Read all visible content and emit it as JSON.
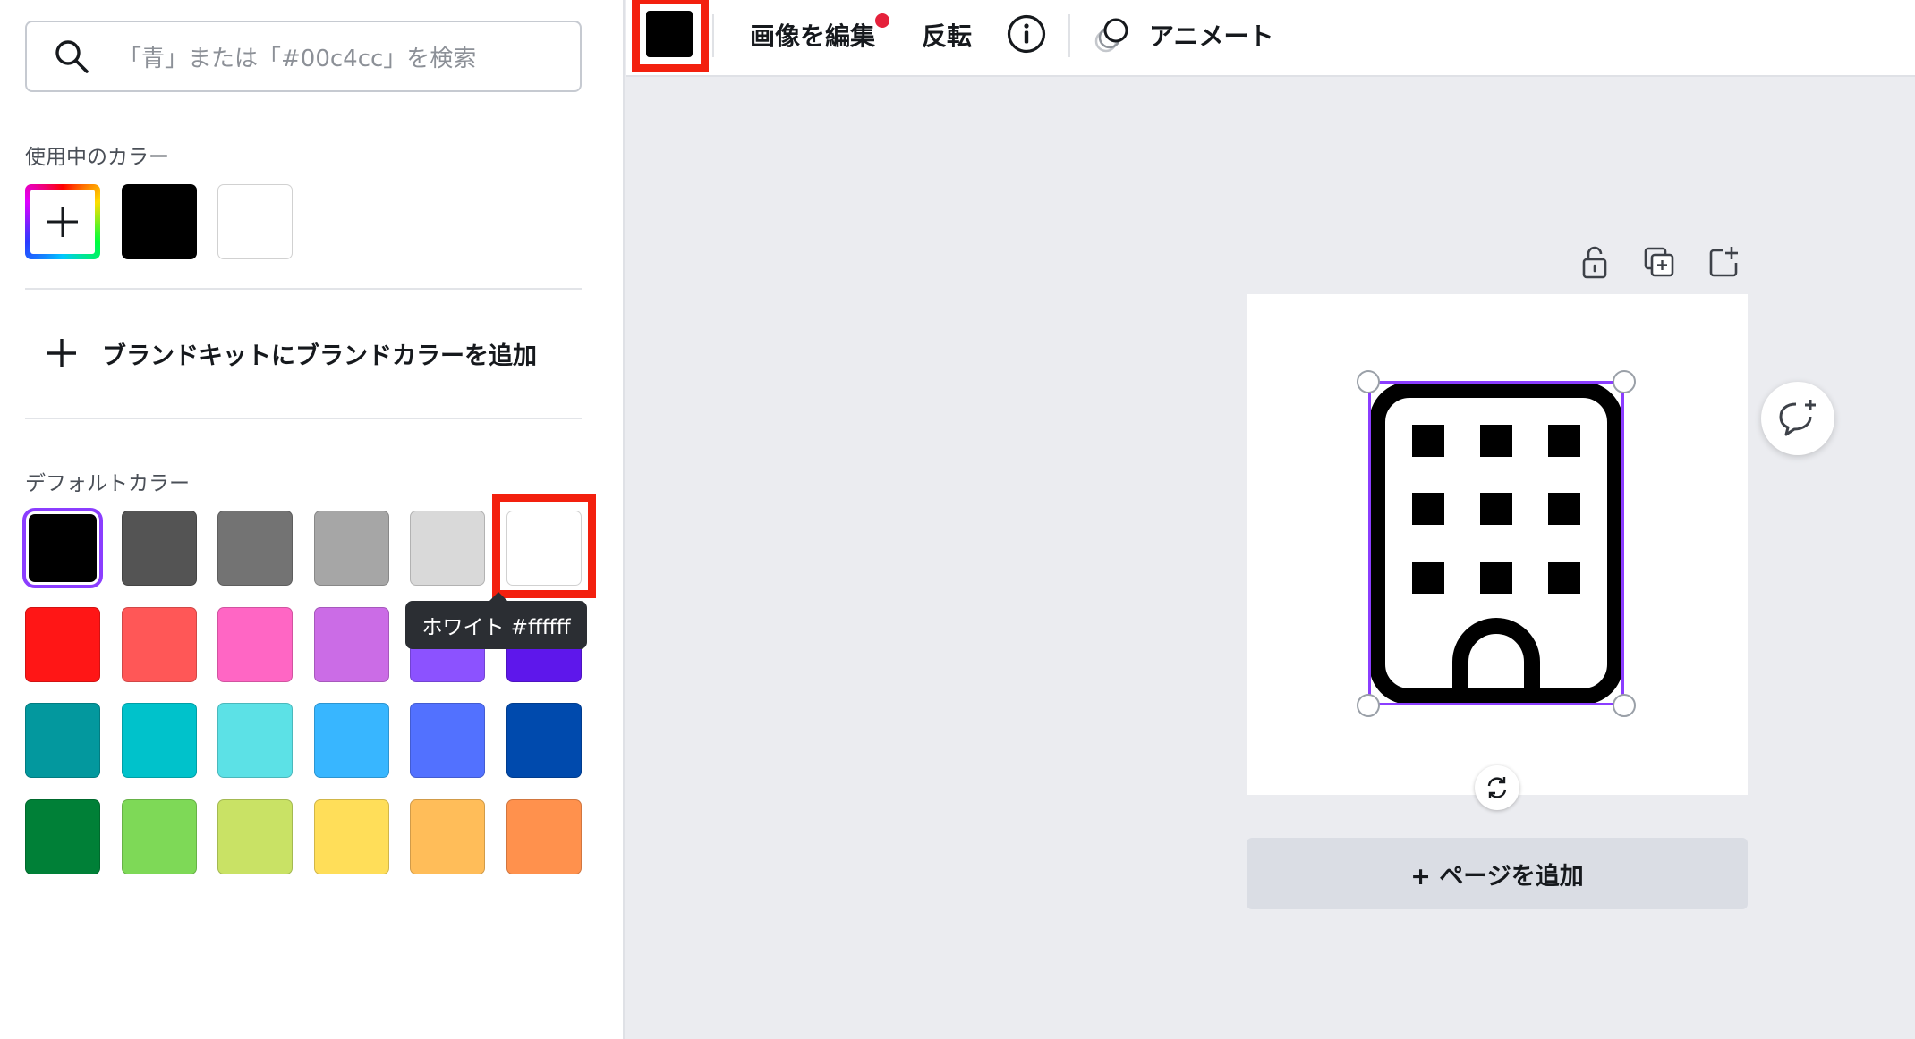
{
  "search": {
    "placeholder": "「青」または「#00c4cc」を検索",
    "icon": "search-icon"
  },
  "in_use": {
    "label": "使用中のカラー",
    "swatches": [
      "#000000",
      "#ffffff"
    ]
  },
  "brand_kit": {
    "label": "ブランドキットにブランドカラーを追加",
    "icon": "plus-icon"
  },
  "defaults": {
    "label": "デフォルトカラー",
    "selected": "#000000",
    "colors": [
      [
        "#000000",
        "#545454",
        "#737373",
        "#a6a6a6",
        "#d9d9d9",
        "#ffffff"
      ],
      [
        "#ff1616",
        "#ff5757",
        "#ff66c4",
        "#cb6ce6",
        "#8c52ff",
        "#5e17eb"
      ],
      [
        "#03989e",
        "#00c2cb",
        "#5ce1e6",
        "#38b6ff",
        "#5271ff",
        "#004aad"
      ],
      [
        "#008037",
        "#7ed957",
        "#c9e265",
        "#ffde59",
        "#ffbd59",
        "#ff914d"
      ]
    ]
  },
  "tooltip": {
    "text": "ホワイト #ffffff"
  },
  "highlight_color": "#f3200e",
  "accent_color": "#8b3dff",
  "toolbar": {
    "current_color": "#000000",
    "edit_image": "画像を編集",
    "flip": "反転",
    "info_icon": "info-icon",
    "animate": "アニメート",
    "animate_icon": "animate-circles-icon"
  },
  "canvas": {
    "element": "office-building-icon",
    "tools": [
      "unlock-icon",
      "duplicate-page-icon",
      "add-page-icon"
    ],
    "rotate_icon": "rotate-icon",
    "comment_icon": "add-comment-icon"
  },
  "add_page": {
    "label": "+ ページを追加"
  }
}
